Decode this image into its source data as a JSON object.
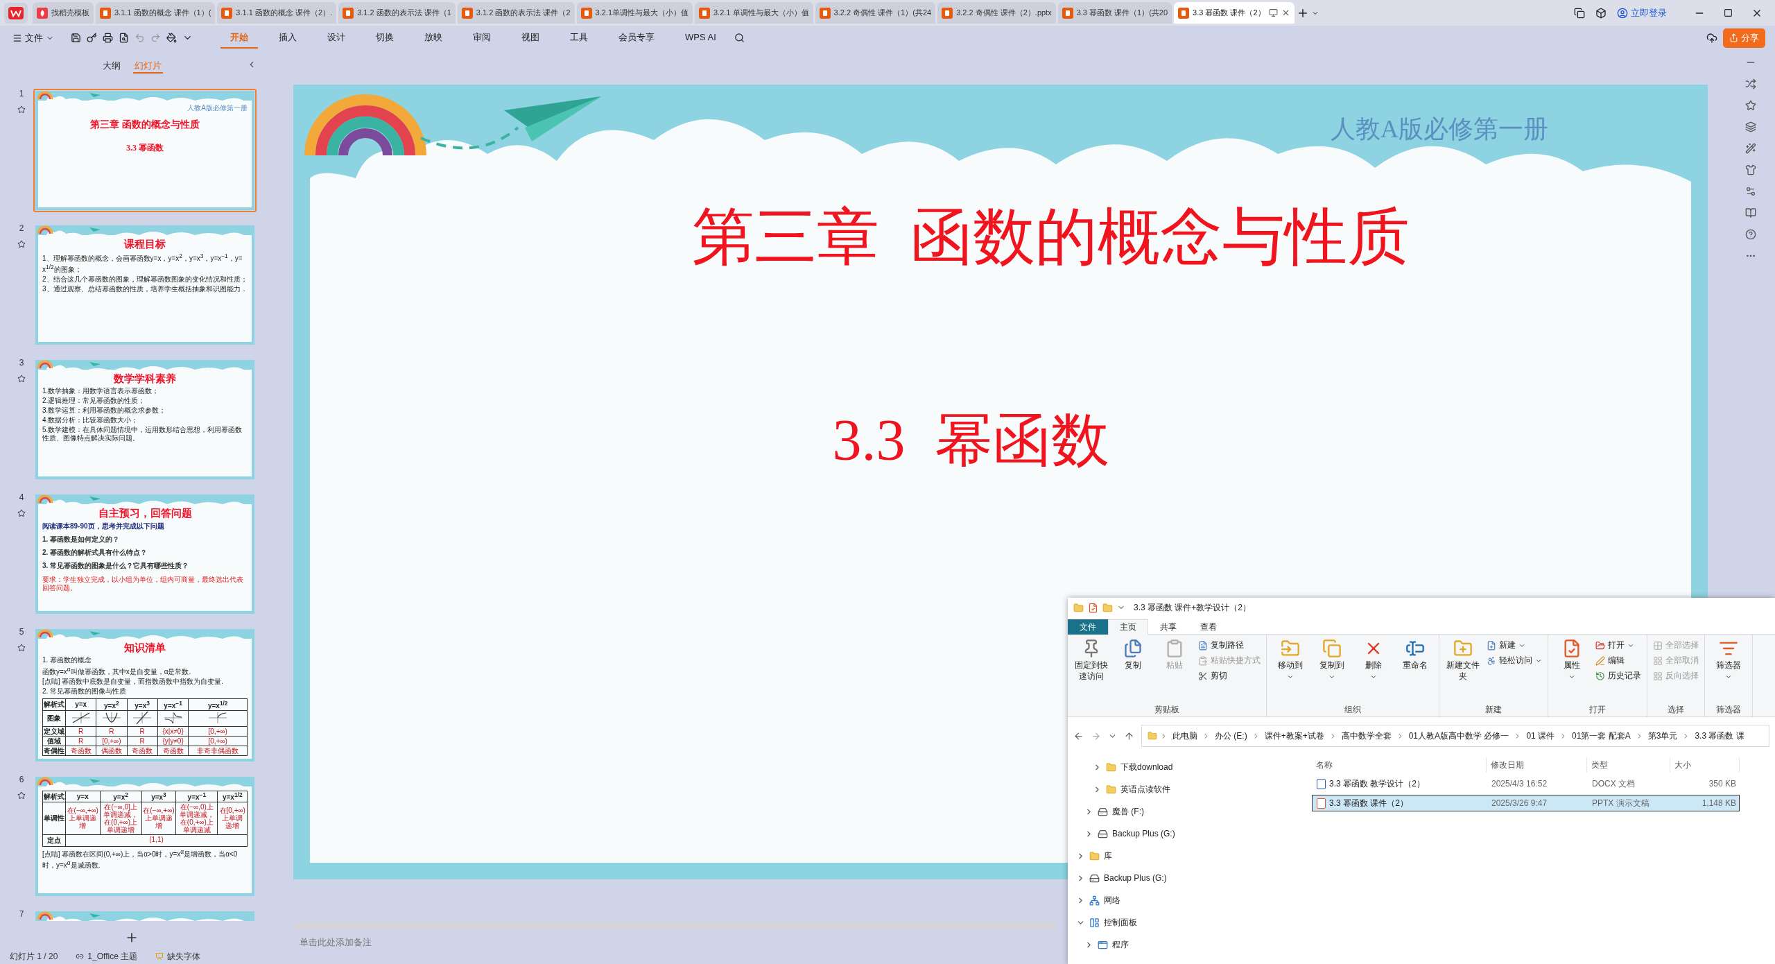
{
  "app_tabs": [
    {
      "label": "找稻壳模板",
      "kind": "template",
      "selected": false
    },
    {
      "label": "3.1.1 函数的概念 课件（1）(",
      "kind": "pptx",
      "selected": false
    },
    {
      "label": "3.1.1 函数的概念 课件（2）.",
      "kind": "pptx",
      "selected": false
    },
    {
      "label": "3.1.2 函数的表示法 课件（1",
      "kind": "pptx",
      "selected": false
    },
    {
      "label": "3.1.2 函数的表示法 课件（2",
      "kind": "pptx",
      "selected": false
    },
    {
      "label": "3.2.1单调性与最大（小）值",
      "kind": "pptx",
      "selected": false
    },
    {
      "label": "3.2.1 单调性与最大（小）值",
      "kind": "pptx",
      "selected": false
    },
    {
      "label": "3.2.2 奇偶性 课件（1）(共24",
      "kind": "pptx",
      "selected": false
    },
    {
      "label": "3.2.2 奇偶性 课件（2）.pptx",
      "kind": "pptx",
      "selected": false
    },
    {
      "label": "3.3 幂函数 课件（1）(共20",
      "kind": "pptx",
      "selected": false
    },
    {
      "label": "3.3 幂函数 课件（2）",
      "kind": "pptx",
      "selected": true
    }
  ],
  "account": {
    "login": "立即登录"
  },
  "toolbar": {
    "file_menu": "文件",
    "ribbon_tabs": [
      {
        "label": "开始",
        "selected": true
      },
      {
        "label": "插入",
        "selected": false
      },
      {
        "label": "设计",
        "selected": false
      },
      {
        "label": "切换",
        "selected": false
      },
      {
        "label": "放映",
        "selected": false
      },
      {
        "label": "审阅",
        "selected": false
      },
      {
        "label": "视图",
        "selected": false
      },
      {
        "label": "工具",
        "selected": false
      },
      {
        "label": "会员专享",
        "selected": false
      },
      {
        "label": "WPS AI",
        "selected": false
      }
    ],
    "share": "分享"
  },
  "slide_panel": {
    "view_tabs": [
      {
        "label": "大纲",
        "selected": false
      },
      {
        "label": "幻灯片",
        "selected": true
      }
    ],
    "slides": [
      {
        "number": "1",
        "selected": true,
        "kind": "title",
        "publisher": "人教A版必修第一册",
        "chapter": "第三章  函数的概念与性质",
        "title": "3.3  幂函数"
      },
      {
        "number": "2",
        "selected": false,
        "kind": "list",
        "title": "课程目标",
        "lines": [
          "1、理解幂函数的概念，会画幂函数y=x，y=x$^{2}$，y=x$^{3}$，y=x$^{−1}$，y= x$^{1/2}$的图象；",
          "2、结合这几个幂函数的图象，理解幂函数图象的变化情况和性质；",
          "3、通过观察、总结幂函数的性质，培养学生概括抽象和识图能力．"
        ]
      },
      {
        "number": "3",
        "selected": false,
        "kind": "list",
        "title": "数学学科素养",
        "lines": [
          "1.数学抽象：用数学语言表示幂函数；",
          "2.逻辑推理：常见幂函数的性质；",
          "3.数学运算：利用幂函数的概念求参数；",
          "4.数据分析：比较幂函数大小；",
          "5.数学建模：在具体问题情境中，运用数形结合思想，利用幂函数性质、图像特点解决实际问题。"
        ]
      },
      {
        "number": "4",
        "selected": false,
        "kind": "questions",
        "title": "自主预习，回答问题",
        "subtitle": "阅读课本89-90页，思考并完成以下问题",
        "lines": [
          "1. 幂函数是如何定义的？",
          "2. 幂函数的解析式具有什么特点？",
          "3. 常见幂函数的图象是什么？它具有哪些性质？"
        ],
        "note": "要求：学生独立完成，以小组为单位，组内可商量，最终选出代表回答问题。"
      },
      {
        "number": "5",
        "selected": false,
        "kind": "table",
        "title": "知识清单",
        "lines": [
          "1. 幂函数的概念",
          "函数y=x$^{α}$叫做幂函数，其中x是自变量，α是常数.",
          "[点睛] 幂函数中底数是自变量，而指数函数中指数为自变量.",
          "2. 常见幂函数的图像与性质"
        ],
        "rows": [
          {
            "kind": "text",
            "cells": [
              "解析式",
              "y=x",
              "y=x$^{2}$",
              "y=x$^{3}$",
              "y=x$^{−1}$",
              "y=x$^{1/2}$"
            ]
          },
          {
            "kind": "graph",
            "cells": [
              "图象"
            ],
            "curves": [
              {
                "kind": "line"
              },
              {
                "kind": "parabola"
              },
              {
                "kind": "cubic"
              },
              {
                "kind": "hyperbola"
              },
              {
                "kind": "root"
              }
            ]
          },
          {
            "kind": "text",
            "cells": [
              "定义域",
              "R",
              "R",
              "R",
              "{x|x≠0}",
              "[0,+∞)"
            ]
          },
          {
            "kind": "text",
            "cells": [
              "值域",
              "R",
              "[0,+∞)",
              "R",
              "{y|y≠0}",
              "[0,+∞)"
            ]
          },
          {
            "kind": "text",
            "cells": [
              "奇偶性",
              "奇函数",
              "偶函数",
              "奇函数",
              "奇函数",
              "非奇非偶函数"
            ]
          }
        ]
      },
      {
        "number": "6",
        "selected": false,
        "kind": "table",
        "rows": [
          {
            "kind": "text",
            "cells": [
              "解析式",
              "y=x",
              "y=x$^{2}$",
              "y=x$^{3}$",
              "y=x$^{−1}$",
              "y=x$^{1/2}$"
            ]
          },
          {
            "kind": "text",
            "cells": [
              "单调性",
              "在(−∞,+∞)上单调递增",
              "在(−∞,0]上单调递减，在(0,+∞)上单调递增",
              "在(−∞,+∞)上单调递增",
              "在(−∞,0)上单调递减，在(0,+∞)上单调递减",
              "在[0,+∞)上单调递增"
            ]
          }
        ],
        "footer_row": {
          "label": "定点",
          "value": "(1,1)"
        },
        "note": "[点睛] 幂函数在区间(0,+∞)上，当α>0时，y=x$^{α}$是增函数，当α<0时，y=x$^{α}$是减函数."
      },
      {
        "number": "7",
        "selected": false,
        "kind": "cut"
      }
    ]
  },
  "slide": {
    "publisher": "人教A版必修第一册",
    "chapter": "第三章  函数的概念与性质",
    "title": "3.3  幂函数"
  },
  "notes": {
    "placeholder": "单击此处添加备注"
  },
  "status_bar": {
    "slide_count": "幻灯片 1 / 20",
    "theme": "1_Office 主题",
    "missing_fonts": "缺失字体"
  },
  "explorer": {
    "title": "3.3 幂函数 课件+教学设计（2）",
    "tabs": [
      {
        "label": "文件",
        "kind": "file",
        "selected": false
      },
      {
        "label": "主页",
        "kind": "tab",
        "selected": true
      },
      {
        "label": "共享",
        "kind": "tab",
        "selected": false
      },
      {
        "label": "查看",
        "kind": "tab",
        "selected": false
      }
    ],
    "groups": [
      {
        "label": "剪贴板",
        "commands": [
          {
            "label": "固定到快速访问",
            "kind": "large",
            "disabled": false,
            "dropdown": false
          },
          {
            "label": "复制",
            "kind": "large",
            "disabled": false,
            "dropdown": false
          },
          {
            "label": "粘贴",
            "kind": "large",
            "disabled": true,
            "dropdown": false
          },
          {
            "label": "复制路径",
            "kind": "small",
            "disabled": false,
            "dropdown": false
          },
          {
            "label": "粘贴快捷方式",
            "kind": "small",
            "disabled": true,
            "dropdown": false
          },
          {
            "label": "剪切",
            "kind": "small",
            "disabled": false,
            "dropdown": false
          }
        ]
      },
      {
        "label": "组织",
        "commands": [
          {
            "label": "移动到",
            "kind": "large",
            "disabled": false,
            "dropdown": true
          },
          {
            "label": "复制到",
            "kind": "large",
            "disabled": false,
            "dropdown": true
          },
          {
            "label": "删除",
            "kind": "large",
            "disabled": false,
            "dropdown": true
          },
          {
            "label": "重命名",
            "kind": "large",
            "disabled": false,
            "dropdown": false
          }
        ]
      },
      {
        "label": "新建",
        "commands": [
          {
            "label": "新建文件夹",
            "kind": "large",
            "disabled": false,
            "dropdown": false
          },
          {
            "label": "新建",
            "kind": "small",
            "disabled": false,
            "dropdown": true
          },
          {
            "label": "轻松访问",
            "kind": "small",
            "disabled": false,
            "dropdown": true
          }
        ]
      },
      {
        "label": "打开",
        "commands": [
          {
            "label": "属性",
            "kind": "large",
            "disabled": false,
            "dropdown": true
          },
          {
            "label": "打开",
            "kind": "small",
            "disabled": false,
            "dropdown": true
          },
          {
            "label": "编辑",
            "kind": "small",
            "disabled": false,
            "dropdown": false
          },
          {
            "label": "历史记录",
            "kind": "small",
            "disabled": false,
            "dropdown": false
          }
        ]
      },
      {
        "label": "选择",
        "commands": [
          {
            "label": "全部选择",
            "kind": "small",
            "disabled": true,
            "dropdown": false
          },
          {
            "label": "全部取消",
            "kind": "small",
            "disabled": true,
            "dropdown": false
          },
          {
            "label": "反向选择",
            "kind": "small",
            "disabled": true,
            "dropdown": false
          }
        ]
      },
      {
        "label": "筛选器",
        "commands": [
          {
            "label": "筛选器",
            "kind": "large",
            "disabled": false,
            "dropdown": true
          }
        ]
      }
    ],
    "breadcrumbs": [
      "此电脑",
      "办公 (E:)",
      "课件+教案+试卷",
      "高中数学全套",
      "01人教A版高中数学 必修一",
      "01 课件",
      "01第一套 配套A",
      "第3单元",
      "3.3 幂函数 课"
    ],
    "nav": [
      {
        "children": [
          {
            "children": [
              {
                "label": "下载download",
                "kind": "folder",
                "expanded": false
              },
              {
                "label": "英语点读软件",
                "kind": "folder",
                "expanded": false
              }
            ]
          },
          {
            "label": "魔兽 (F:)",
            "kind": "drive",
            "expanded": false
          },
          {
            "label": "Backup Plus (G:)",
            "kind": "drive",
            "expanded": false
          }
        ]
      },
      {
        "label": "库",
        "kind": "folder",
        "expanded": false
      },
      {
        "label": "Backup Plus (G:)",
        "kind": "drive",
        "expanded": false
      },
      {
        "label": "网络",
        "kind": "network",
        "expanded": false
      },
      {
        "label": "控制面板",
        "kind": "control",
        "expanded": true,
        "children": [
          {
            "label": "程序",
            "kind": "program",
            "expanded": false
          }
        ]
      }
    ],
    "columns": [
      "名称",
      "修改日期",
      "类型",
      "大小"
    ],
    "files": [
      {
        "name": "3.3 幂函数 教学设计（2）",
        "modified": "2025/4/3 16:52",
        "type": "DOCX 文档",
        "size": "350 KB",
        "kind": "docx",
        "selected": false
      },
      {
        "name": "3.3 幂函数 课件（2）",
        "modified": "2025/3/26 9:47",
        "type": "PPTX 演示文稿",
        "size": "1,148 KB",
        "kind": "pptx",
        "selected": true
      }
    ]
  }
}
